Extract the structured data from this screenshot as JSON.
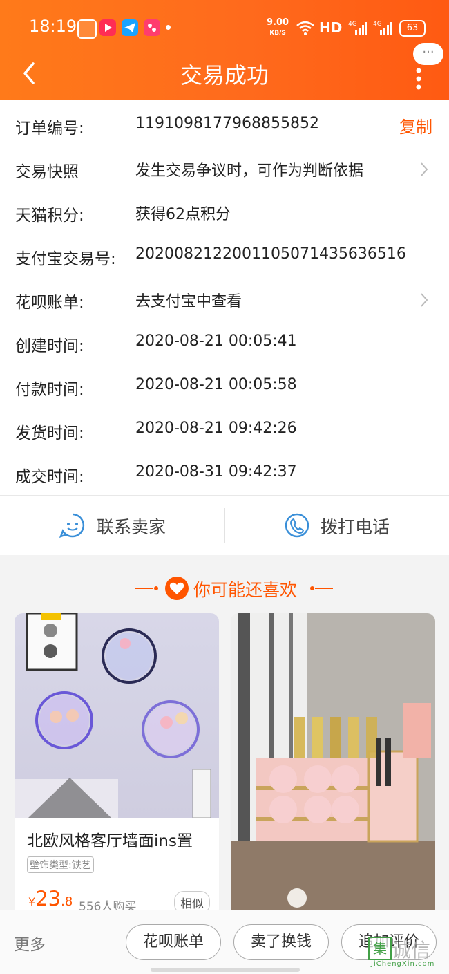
{
  "status_bar": {
    "time": "18:19",
    "net_speed_value": "9.00",
    "net_speed_unit": "KB/S",
    "signal_hd": "HD",
    "battery": "63",
    "net_types": [
      "4G",
      "4G"
    ]
  },
  "nav": {
    "title": "交易成功",
    "more_bubble": "···"
  },
  "order_rows": [
    {
      "label": "订单编号:",
      "value": "1191098177968855852",
      "action": "复制"
    },
    {
      "label": "交易快照",
      "value": "发生交易争议时，可作为判断依据"
    },
    {
      "label": "天猫积分:",
      "value": "获得62点积分"
    },
    {
      "label": "支付宝交易号:",
      "value": "2020082122001105071435636516"
    },
    {
      "label": "花呗账单:",
      "value": "去支付宝中查看"
    },
    {
      "label": "创建时间:",
      "value": "2020-08-21 00:05:41"
    },
    {
      "label": "付款时间:",
      "value": "2020-08-21 00:05:58"
    },
    {
      "label": "发货时间:",
      "value": "2020-08-21 09:42:26"
    },
    {
      "label": "成交时间:",
      "value": "2020-08-31 09:42:37"
    }
  ],
  "contact": {
    "seller": "联系卖家",
    "phone": "拨打电话"
  },
  "recommend": {
    "title": "你可能还喜欢",
    "products": [
      {
        "name": "北欧风格客厅墙面ins置",
        "tag": "壁饰类型:铁艺",
        "price_symbol": "¥",
        "price_int": "23",
        "price_dec": ".8",
        "sales": "556人购买",
        "similar": "相似"
      }
    ]
  },
  "bottom_bar": {
    "more": "更多",
    "buttons": [
      "花呗账单",
      "卖了换钱",
      "追加评价"
    ]
  },
  "watermark": {
    "mark": "集",
    "text": "诚信",
    "sub": "JiChengXin.com"
  },
  "colors": {
    "brand_orange": "#ff6a1c",
    "accent_text": "#ff5500",
    "contact_icon": "#3a8fd8"
  }
}
